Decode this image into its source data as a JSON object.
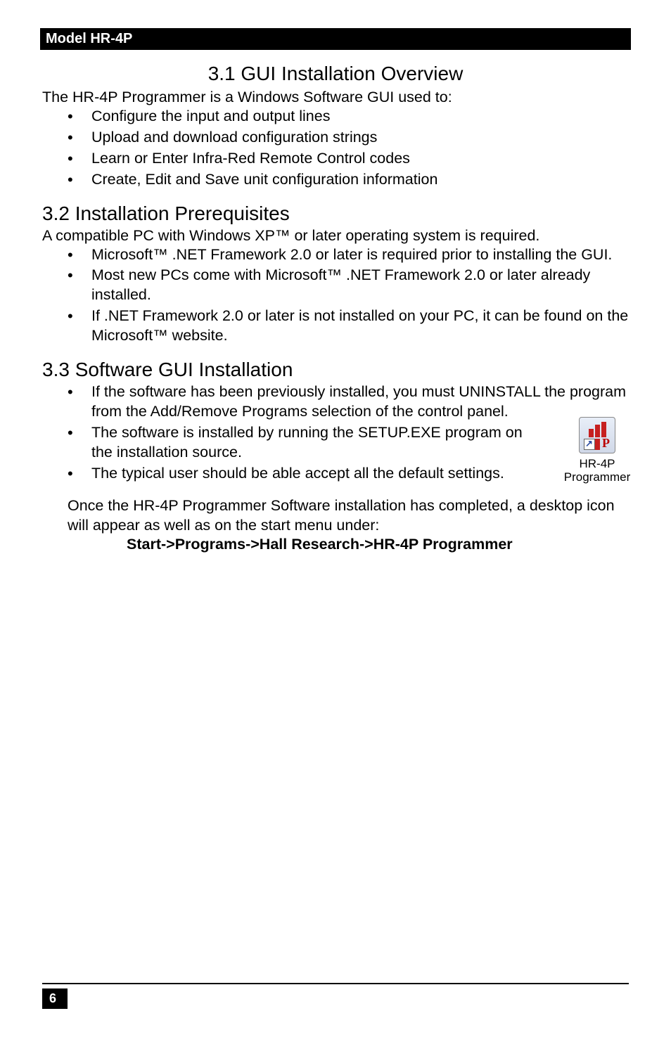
{
  "header": {
    "model": "Model HR-4P"
  },
  "s31": {
    "title": "3.1 GUI Installation Overview",
    "intro": "The HR-4P Programmer is a Windows Software GUI used to:",
    "items": [
      "Configure the input and output lines",
      "Upload and download configuration strings",
      "Learn or Enter Infra-Red Remote Control codes",
      "Create, Edit and Save unit configuration information"
    ]
  },
  "s32": {
    "title": "3.2 Installation Prerequisites",
    "intro": "A compatible PC with Windows XP™ or later operating system is required.",
    "items": [
      "Microsoft™ .NET Framework 2.0 or later is required prior to installing the GUI.",
      "Most new PCs come with Microsoft™ .NET Framework 2.0 or later already installed.",
      "If .NET Framework 2.0 or later is not installed on your PC, it can be found on the Microsoft™ website."
    ]
  },
  "s33": {
    "title": "3.3 Software GUI Installation",
    "items": [
      "If the software has been previously installed, you must UNINSTALL the program from the Add/Remove Programs selection of the control panel.",
      "The software is installed by running the SETUP.EXE program on the installation source.",
      "The typical user should be able accept all the default settings."
    ],
    "after1": "Once the HR-4P Programmer Software installation has completed, a desktop icon will appear as well as on the start menu under:",
    "path": "Start->Programs->Hall Research->HR-4P Programmer"
  },
  "icon": {
    "line1": "HR-4P",
    "line2": "Programmer"
  },
  "page": "6"
}
